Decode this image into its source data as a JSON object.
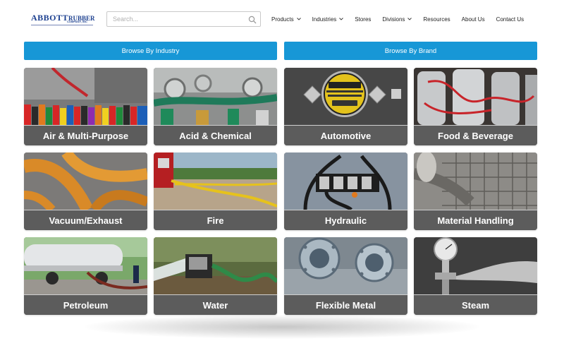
{
  "logo": {
    "name_part1": "ABBOTT",
    "name_part2": "RUBBER",
    "company": "COMPANY, INC"
  },
  "search": {
    "placeholder": "Search..."
  },
  "nav": {
    "items": [
      {
        "label": "Products",
        "dropdown": true
      },
      {
        "label": "Industries",
        "dropdown": true
      },
      {
        "label": "Stores",
        "dropdown": false
      },
      {
        "label": "Divisions",
        "dropdown": true
      },
      {
        "label": "Resources",
        "dropdown": false
      },
      {
        "label": "About Us",
        "dropdown": false
      },
      {
        "label": "Contact Us",
        "dropdown": false
      }
    ]
  },
  "browse": {
    "industry_label": "Browse By Industry",
    "brand_label": "Browse By Brand"
  },
  "industries": [
    {
      "label": "Air & Multi-Purpose",
      "photo": "air"
    },
    {
      "label": "Acid & Chemical",
      "photo": "acid"
    },
    {
      "label": "Automotive",
      "photo": "auto"
    },
    {
      "label": "Food & Beverage",
      "photo": "food"
    },
    {
      "label": "Vacuum/Exhaust",
      "photo": "vacuum"
    },
    {
      "label": "Fire",
      "photo": "fire"
    },
    {
      "label": "Hydraulic",
      "photo": "hydraulic"
    },
    {
      "label": "Material Handling",
      "photo": "material"
    },
    {
      "label": "Petroleum",
      "photo": "petroleum"
    },
    {
      "label": "Water",
      "photo": "water"
    },
    {
      "label": "Flexible Metal",
      "photo": "metal"
    },
    {
      "label": "Steam",
      "photo": "steam"
    }
  ],
  "colors": {
    "accent": "#1797d6",
    "label_bg": "#5c5c5c",
    "logo_blue": "#1b3f8f"
  }
}
